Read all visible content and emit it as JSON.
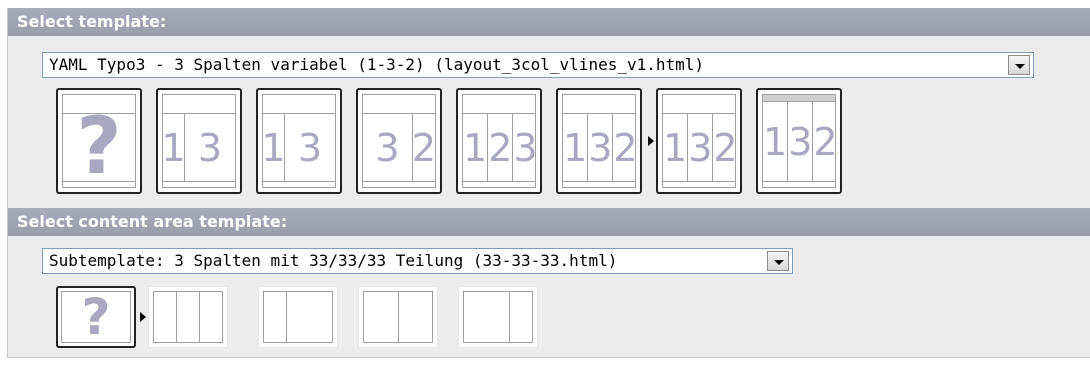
{
  "template_section": {
    "header": "Select template:",
    "selected_value": "YAML Typo3 - 3 Spalten variabel (1-3-2) (layout_3col_vlines_v1.html)",
    "thumbnails": [
      {
        "kind": "unknown",
        "glyph": "?",
        "labels": []
      },
      {
        "kind": "layout",
        "labels": [
          "1",
          "3"
        ]
      },
      {
        "kind": "layout",
        "labels": [
          "1",
          "3"
        ]
      },
      {
        "kind": "layout",
        "labels": [
          "3",
          "2"
        ]
      },
      {
        "kind": "layout",
        "labels": [
          "1",
          "2",
          "3"
        ]
      },
      {
        "kind": "layout",
        "labels": [
          "1",
          "3",
          "2"
        ]
      },
      {
        "kind": "layout",
        "labels": [
          "1",
          "3",
          "2"
        ],
        "selected": true
      },
      {
        "kind": "layout",
        "labels": [
          "1",
          "3",
          "2"
        ]
      }
    ]
  },
  "content_section": {
    "header": "Select content area template:",
    "selected_value": "Subtemplate: 3 Spalten mit 33/33/33 Teilung (33-33-33.html)",
    "thumbnails": [
      {
        "kind": "unknown",
        "glyph": "?"
      },
      {
        "kind": "columns",
        "count": 3,
        "selected": true
      },
      {
        "kind": "columns",
        "count": 2
      },
      {
        "kind": "columns",
        "count": 2
      },
      {
        "kind": "columns",
        "count": 2
      }
    ]
  }
}
